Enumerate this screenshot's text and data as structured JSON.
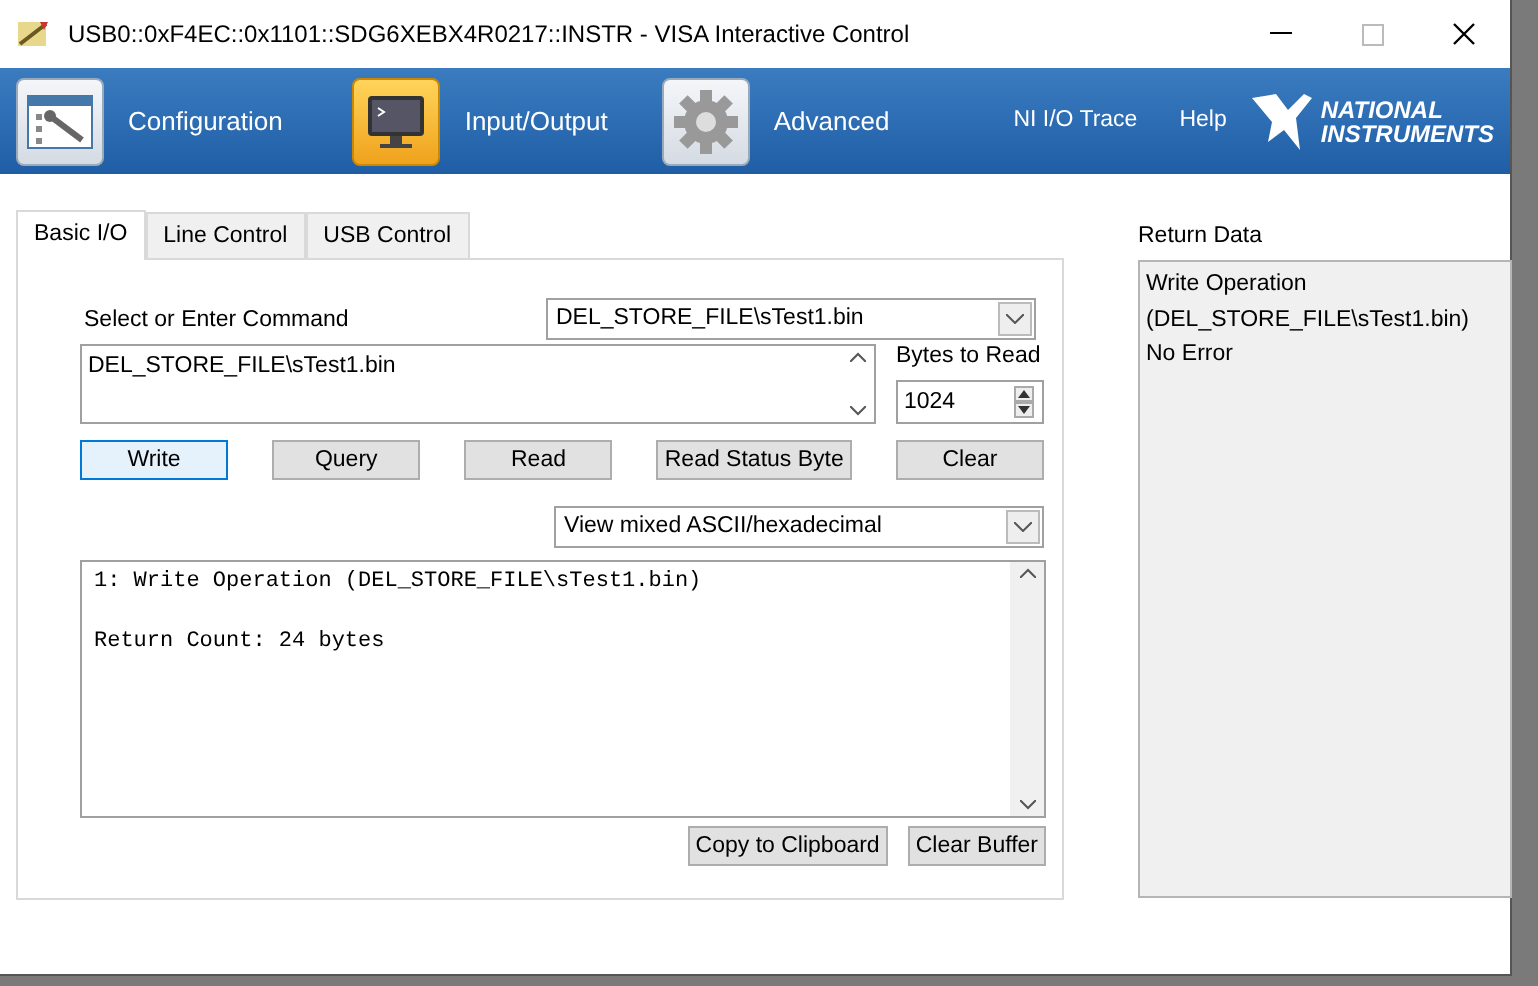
{
  "window": {
    "title": "USB0::0xF4EC::0x1101::SDG6XEBX4R0217::INSTR - VISA Interactive Control"
  },
  "toolbar": {
    "items": [
      {
        "label": "Configuration",
        "kind": "config",
        "selected": false
      },
      {
        "label": "Input/Output",
        "kind": "io",
        "selected": true
      },
      {
        "label": "Advanced",
        "kind": "advanced",
        "selected": false
      }
    ],
    "links": [
      "NI I/O Trace",
      "Help"
    ],
    "logo": [
      "NATIONAL",
      "INSTRUMENTS"
    ]
  },
  "tabs": [
    {
      "label": "Basic I/O",
      "selected": true
    },
    {
      "label": "Line Control",
      "selected": false
    },
    {
      "label": "USB Control",
      "selected": false
    }
  ],
  "command": {
    "label": "Select or Enter Command",
    "combo_value": "DEL_STORE_FILE\\sTest1.bin",
    "text": "DEL_STORE_FILE\\sTest1.bin"
  },
  "bytes_to_read": {
    "label": "Bytes to Read",
    "value": "1024"
  },
  "actions": [
    {
      "label": "Write",
      "focused": true
    },
    {
      "label": "Query",
      "focused": false
    },
    {
      "label": "Read",
      "focused": false
    },
    {
      "label": "Read Status Byte",
      "focused": false
    },
    {
      "label": "Clear",
      "focused": false
    }
  ],
  "view_mode": "View mixed ASCII/hexadecimal",
  "output": [
    {
      "text": "1: Write Operation (DEL_STORE_FILE\\sTest1.bin)",
      "blank_before": false
    },
    {
      "text": "Return Count: 24 bytes",
      "blank_before": true
    }
  ],
  "output_buttons": [
    "Copy to Clipboard",
    "Clear Buffer"
  ],
  "return_data": {
    "label": "Return Data",
    "lines": [
      "Write Operation",
      "(DEL_STORE_FILE\\sTest1.bin)",
      "No Error"
    ]
  }
}
